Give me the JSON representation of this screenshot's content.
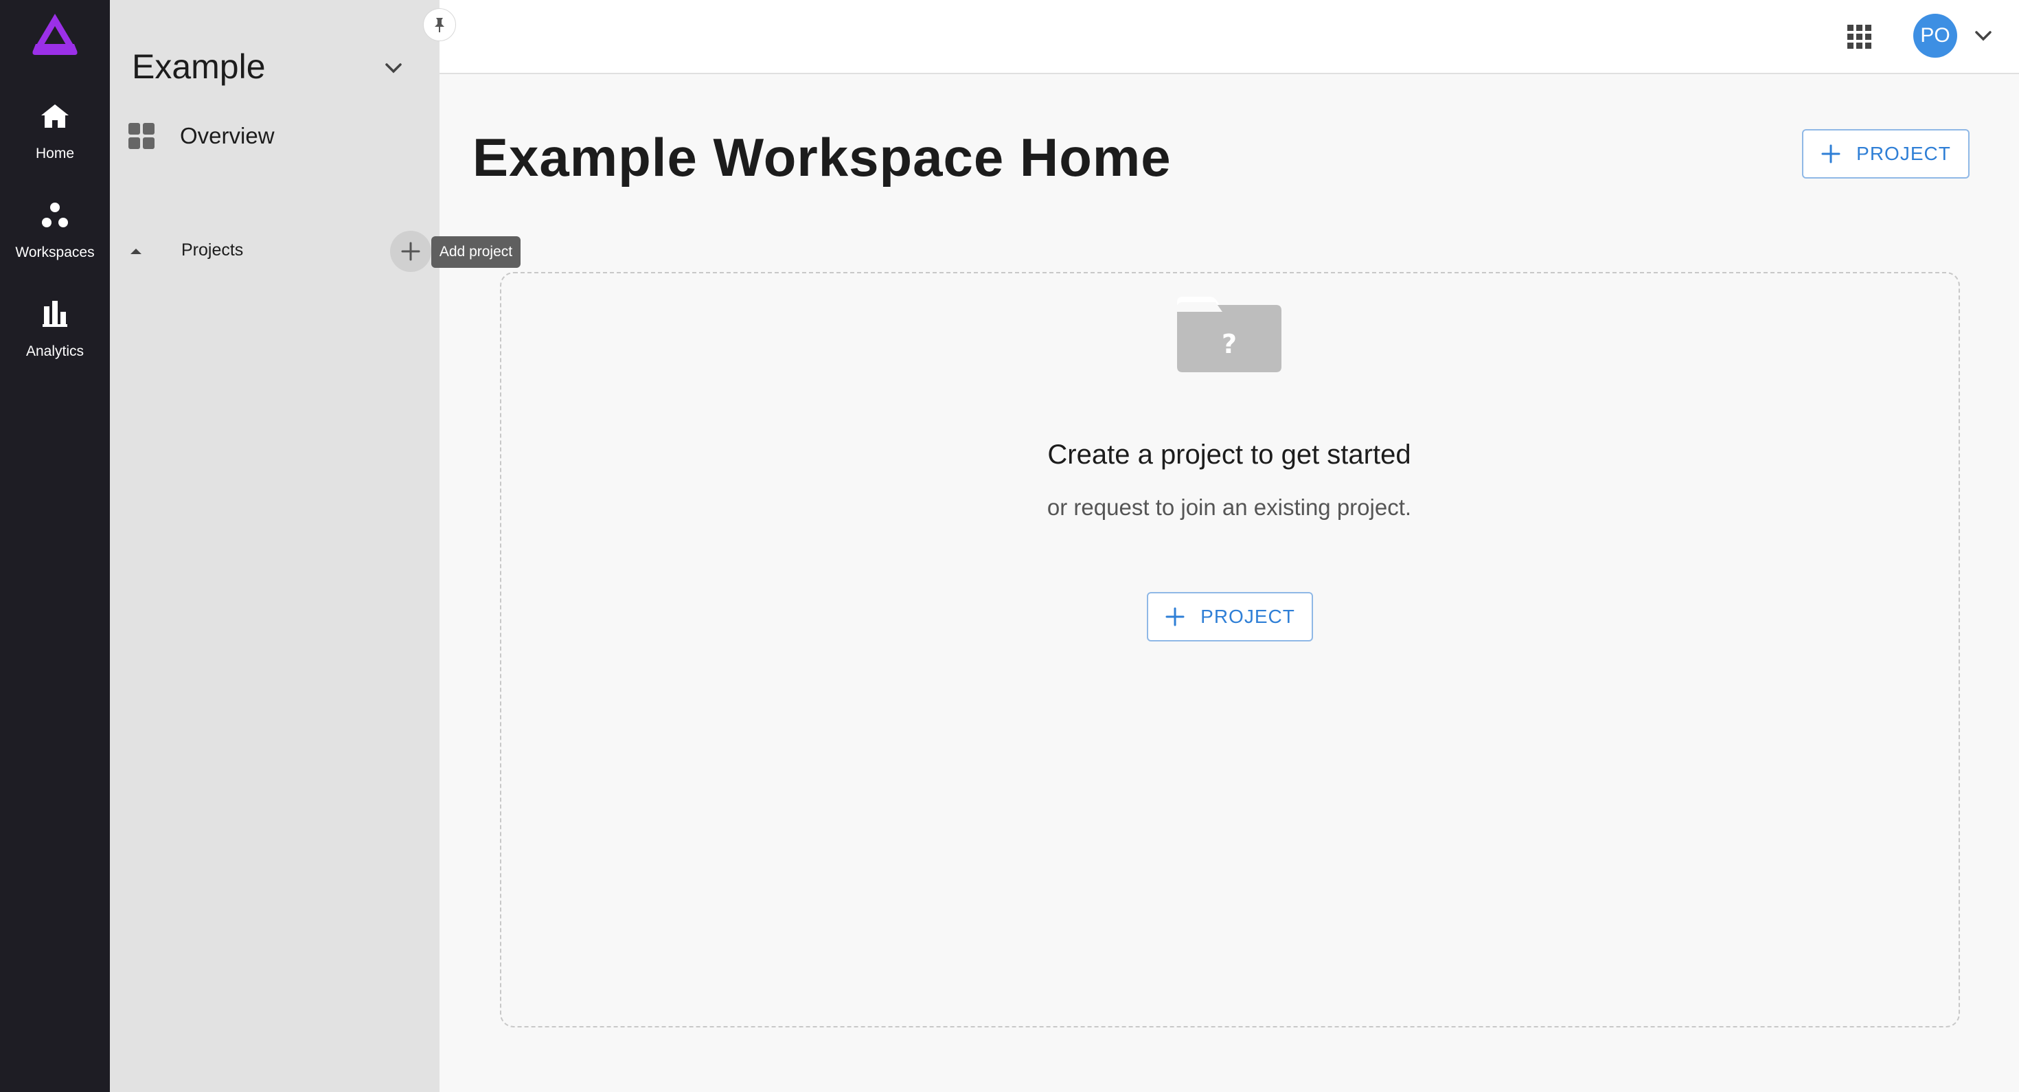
{
  "rail": {
    "items": [
      {
        "label": "Home",
        "icon": "home-icon"
      },
      {
        "label": "Workspaces",
        "icon": "workspaces-icon"
      },
      {
        "label": "Analytics",
        "icon": "bar-chart-icon"
      }
    ]
  },
  "sidebar": {
    "workspace_name": "Example",
    "overview_label": "Overview",
    "projects_label": "Projects",
    "add_project_tooltip": "Add project"
  },
  "topbar": {
    "avatar_initials": "PO"
  },
  "main": {
    "title": "Example Workspace Home",
    "project_button_label": "PROJECT",
    "empty": {
      "folder_glyph": "?",
      "title": "Create a project to get started",
      "subtitle": "or request to join an existing project.",
      "button_label": "PROJECT"
    }
  },
  "colors": {
    "rail_bg": "#1e1d24",
    "sidebar_bg": "#e2e2e2",
    "brand_purple": "#9b30e8",
    "accent_blue": "#2f7fd6",
    "avatar_blue": "#3d8fe3"
  }
}
